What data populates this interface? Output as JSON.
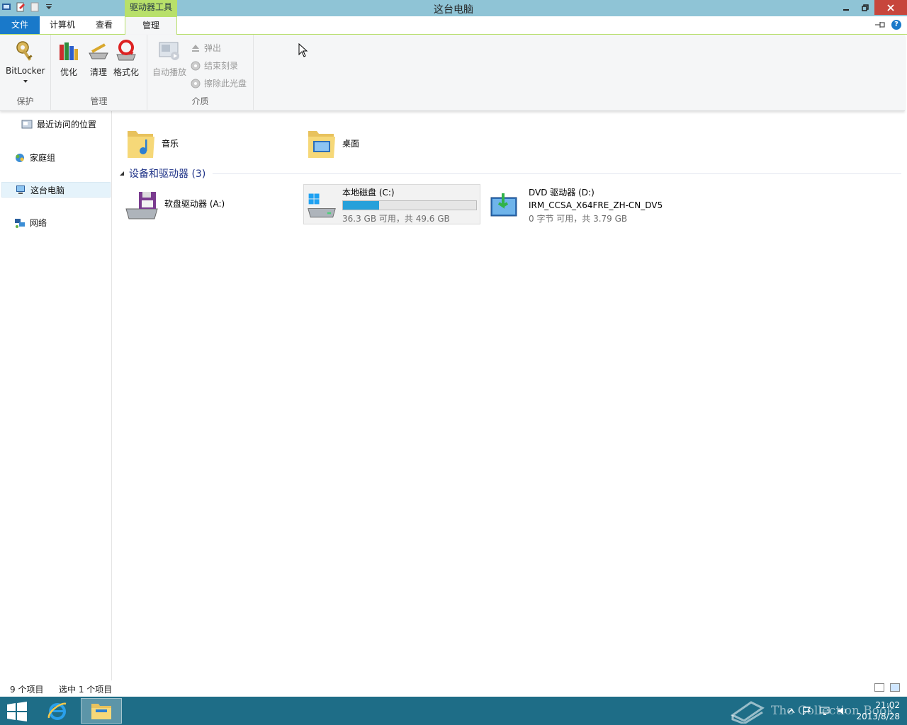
{
  "window": {
    "title": "这台电脑",
    "context_tab_group": "驱动器工具"
  },
  "ribbon_tabs": {
    "file": "文件",
    "computer": "计算机",
    "view": "查看",
    "manage": "管理"
  },
  "ribbon": {
    "protect_group": {
      "label": "保护",
      "bitlocker": "BitLocker"
    },
    "manage_group": {
      "label": "管理",
      "optimize": "优化",
      "cleanup": "清理",
      "format": "格式化"
    },
    "media_group": {
      "label": "介质",
      "autoplay": "自动播放",
      "eject": "弹出",
      "finish_burning": "结束刻录",
      "erase_disc": "擦除此光盘"
    }
  },
  "nav": {
    "recent_places": "最近访问的位置",
    "homegroup": "家庭组",
    "this_pc": "这台电脑",
    "network": "网络"
  },
  "folders": {
    "music": "音乐",
    "desktop": "桌面"
  },
  "devices_section": {
    "header": "设备和驱动器 (3)",
    "floppy": {
      "name": "软盘驱动器 (A:)"
    },
    "local_disk": {
      "name": "本地磁盘 (C:)",
      "space": "36.3 GB 可用，共 49.6 GB",
      "used_fraction": 0.27
    },
    "dvd": {
      "name": "DVD 驱动器 (D:)",
      "label": "IRM_CCSA_X64FRE_ZH-CN_DV5",
      "space": "0 字节 可用，共 3.79 GB"
    }
  },
  "status": {
    "item_count": "9 个项目",
    "selected": "选中 1 个项目"
  },
  "taskbar": {
    "time": "21:02",
    "date": "2013/8/28"
  },
  "watermark": "The Collection Book",
  "colors": {
    "titlebar": "#8fc4d6",
    "accent": "#1979ca",
    "context": "#b8e06a",
    "taskbar": "#1e6d87",
    "close": "#c7463c",
    "drive_bar": "#26a0da"
  }
}
